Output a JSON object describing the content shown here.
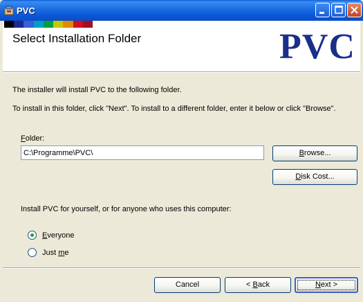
{
  "window": {
    "title": "PVC"
  },
  "banner": {
    "heading": "Select Installation Folder",
    "logo": "PVC",
    "strip_colors": [
      "#000000",
      "#1b2a8e",
      "#3a5fd6",
      "#00a0c8",
      "#00a040",
      "#c8c800",
      "#e08a00",
      "#d01020",
      "#a01020"
    ]
  },
  "body": {
    "intro": "The installer will install PVC to the following folder.",
    "instructions": "To install in this folder, click \"Next\". To install to a different folder, enter it below or click \"Browse\".",
    "folder_label_prefix": "",
    "folder_label_underlined": "F",
    "folder_label_rest": "older:",
    "folder_value": "C:\\Programme\\PVC\\",
    "browse_u": "B",
    "browse_rest": "rowse...",
    "disk_u": "D",
    "disk_rest": "isk Cost...",
    "install_for": "Install PVC for yourself, or for anyone who uses this computer:",
    "radio_everyone_u": "E",
    "radio_everyone_rest": "veryone",
    "radio_justme_pre": "Just ",
    "radio_justme_u": "m",
    "radio_justme_rest": "e",
    "selected_option": "Everyone"
  },
  "footer": {
    "cancel_label": "Cancel",
    "back_pre": "< ",
    "back_u": "B",
    "back_rest": "ack",
    "next_u": "N",
    "next_rest": "ext >"
  },
  "icons": {
    "app": "installer-icon",
    "minimize": "minimize-icon",
    "maximize": "maximize-icon",
    "close": "close-icon"
  }
}
